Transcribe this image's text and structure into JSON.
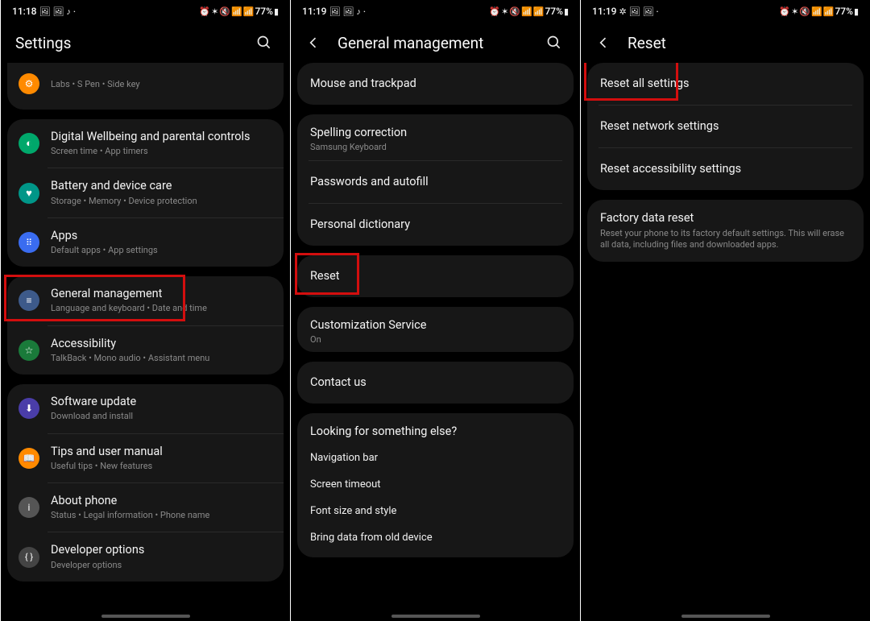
{
  "status": {
    "time1": "11:18",
    "time2": "11:19",
    "time3": "11:19",
    "battery": "77%"
  },
  "screen1": {
    "title": "Settings",
    "partialItem": {
      "sub": "Labs  •  S Pen  •  Side key"
    },
    "card2": [
      {
        "title": "Digital Wellbeing and parental controls",
        "sub": "Screen time  •  App timers"
      },
      {
        "title": "Battery and device care",
        "sub": "Storage  •  Memory  •  Device protection"
      },
      {
        "title": "Apps",
        "sub": "Default apps  •  App settings"
      }
    ],
    "card3": [
      {
        "title": "General management",
        "sub": "Language and keyboard  •  Date and time"
      },
      {
        "title": "Accessibility",
        "sub": "TalkBack  •  Mono audio  •  Assistant menu"
      }
    ],
    "card4": [
      {
        "title": "Software update",
        "sub": "Download and install"
      },
      {
        "title": "Tips and user manual",
        "sub": "Useful tips  •  New features"
      },
      {
        "title": "About phone",
        "sub": "Status  •  Legal information  •  Phone name"
      },
      {
        "title": "Developer options",
        "sub": "Developer options"
      }
    ]
  },
  "screen2": {
    "title": "General management",
    "card1": [
      "Mouse and trackpad"
    ],
    "card2": [
      {
        "title": "Spelling correction",
        "sub": "Samsung Keyboard"
      },
      {
        "title": "Passwords and autofill",
        "sub": ""
      },
      {
        "title": "Personal dictionary",
        "sub": ""
      }
    ],
    "card3": [
      {
        "title": "Reset"
      }
    ],
    "card4": [
      {
        "title": "Customization Service",
        "sub": "On"
      },
      {
        "title": "Contact us"
      }
    ],
    "lookingHeading": "Looking for something else?",
    "lookingItems": [
      "Navigation bar",
      "Screen timeout",
      "Font size and style",
      "Bring data from old device"
    ]
  },
  "screen3": {
    "title": "Reset",
    "card1": [
      "Reset all settings",
      "Reset network settings",
      "Reset accessibility settings"
    ],
    "card2": [
      {
        "title": "Factory data reset",
        "sub": "Reset your phone to its factory default settings. This will erase all data, including files and downloaded apps."
      }
    ]
  }
}
